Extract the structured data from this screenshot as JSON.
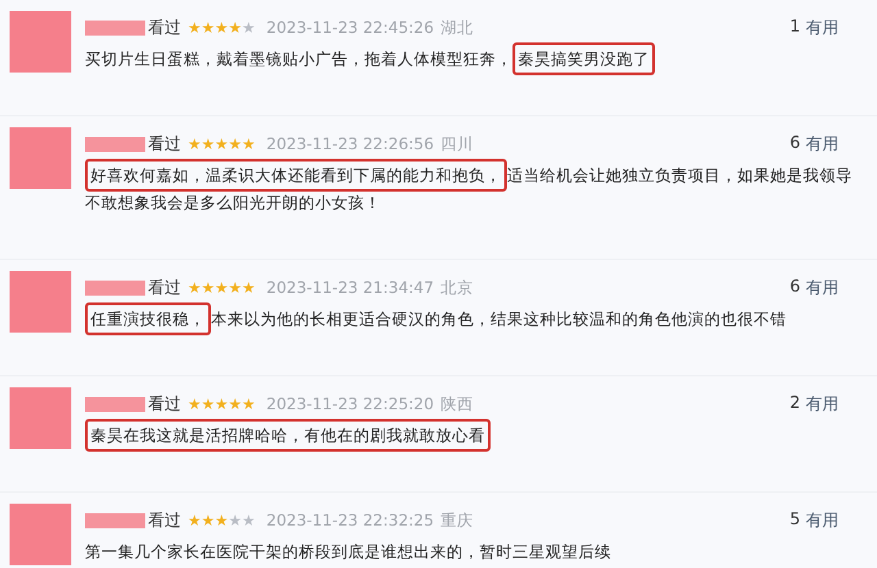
{
  "reviews": [
    {
      "status": "看过",
      "stars": 4,
      "time": "2023-11-23 22:45:26",
      "location": "湖北",
      "votes": "1",
      "votes_label": "有用",
      "segments": [
        {
          "text": "买切片生日蛋糕，戴着墨镜贴小广告，拖着人体模型狂奔，",
          "highlighted": false
        },
        {
          "text": "秦昊搞笑男没跑了",
          "highlighted": true
        }
      ]
    },
    {
      "status": "看过",
      "stars": 5,
      "time": "2023-11-23 22:26:56",
      "location": "四川",
      "votes": "6",
      "votes_label": "有用",
      "segments": [
        {
          "text": "好喜欢何嘉如，温柔识大体还能看到下属的能力和抱负，",
          "highlighted": true
        },
        {
          "text": "适当给机会让她独立负责项目，如果她是我领导不敢想象我会是多么阳光开朗的小女孩！",
          "highlighted": false
        }
      ]
    },
    {
      "status": "看过",
      "stars": 5,
      "time": "2023-11-23 21:34:47",
      "location": "北京",
      "votes": "6",
      "votes_label": "有用",
      "segments": [
        {
          "text": "任重演技很稳，",
          "highlighted": true
        },
        {
          "text": "本来以为他的长相更适合硬汉的角色，结果这种比较温和的角色他演的也很不错",
          "highlighted": false
        }
      ]
    },
    {
      "status": "看过",
      "stars": 5,
      "time": "2023-11-23 22:25:20",
      "location": "陕西",
      "votes": "2",
      "votes_label": "有用",
      "segments": [
        {
          "text": "秦昊在我这就是活招牌哈哈，有他在的剧我就敢放心看",
          "highlighted": true
        }
      ]
    },
    {
      "status": "看过",
      "stars": 3,
      "time": "2023-11-23 22:32:25",
      "location": "重庆",
      "votes": "5",
      "votes_label": "有用",
      "segments": [
        {
          "text": "第一集几个家长在医院干架的桥段到底是谁想出来的，暂时三星观望后续",
          "highlighted": false
        }
      ]
    }
  ]
}
